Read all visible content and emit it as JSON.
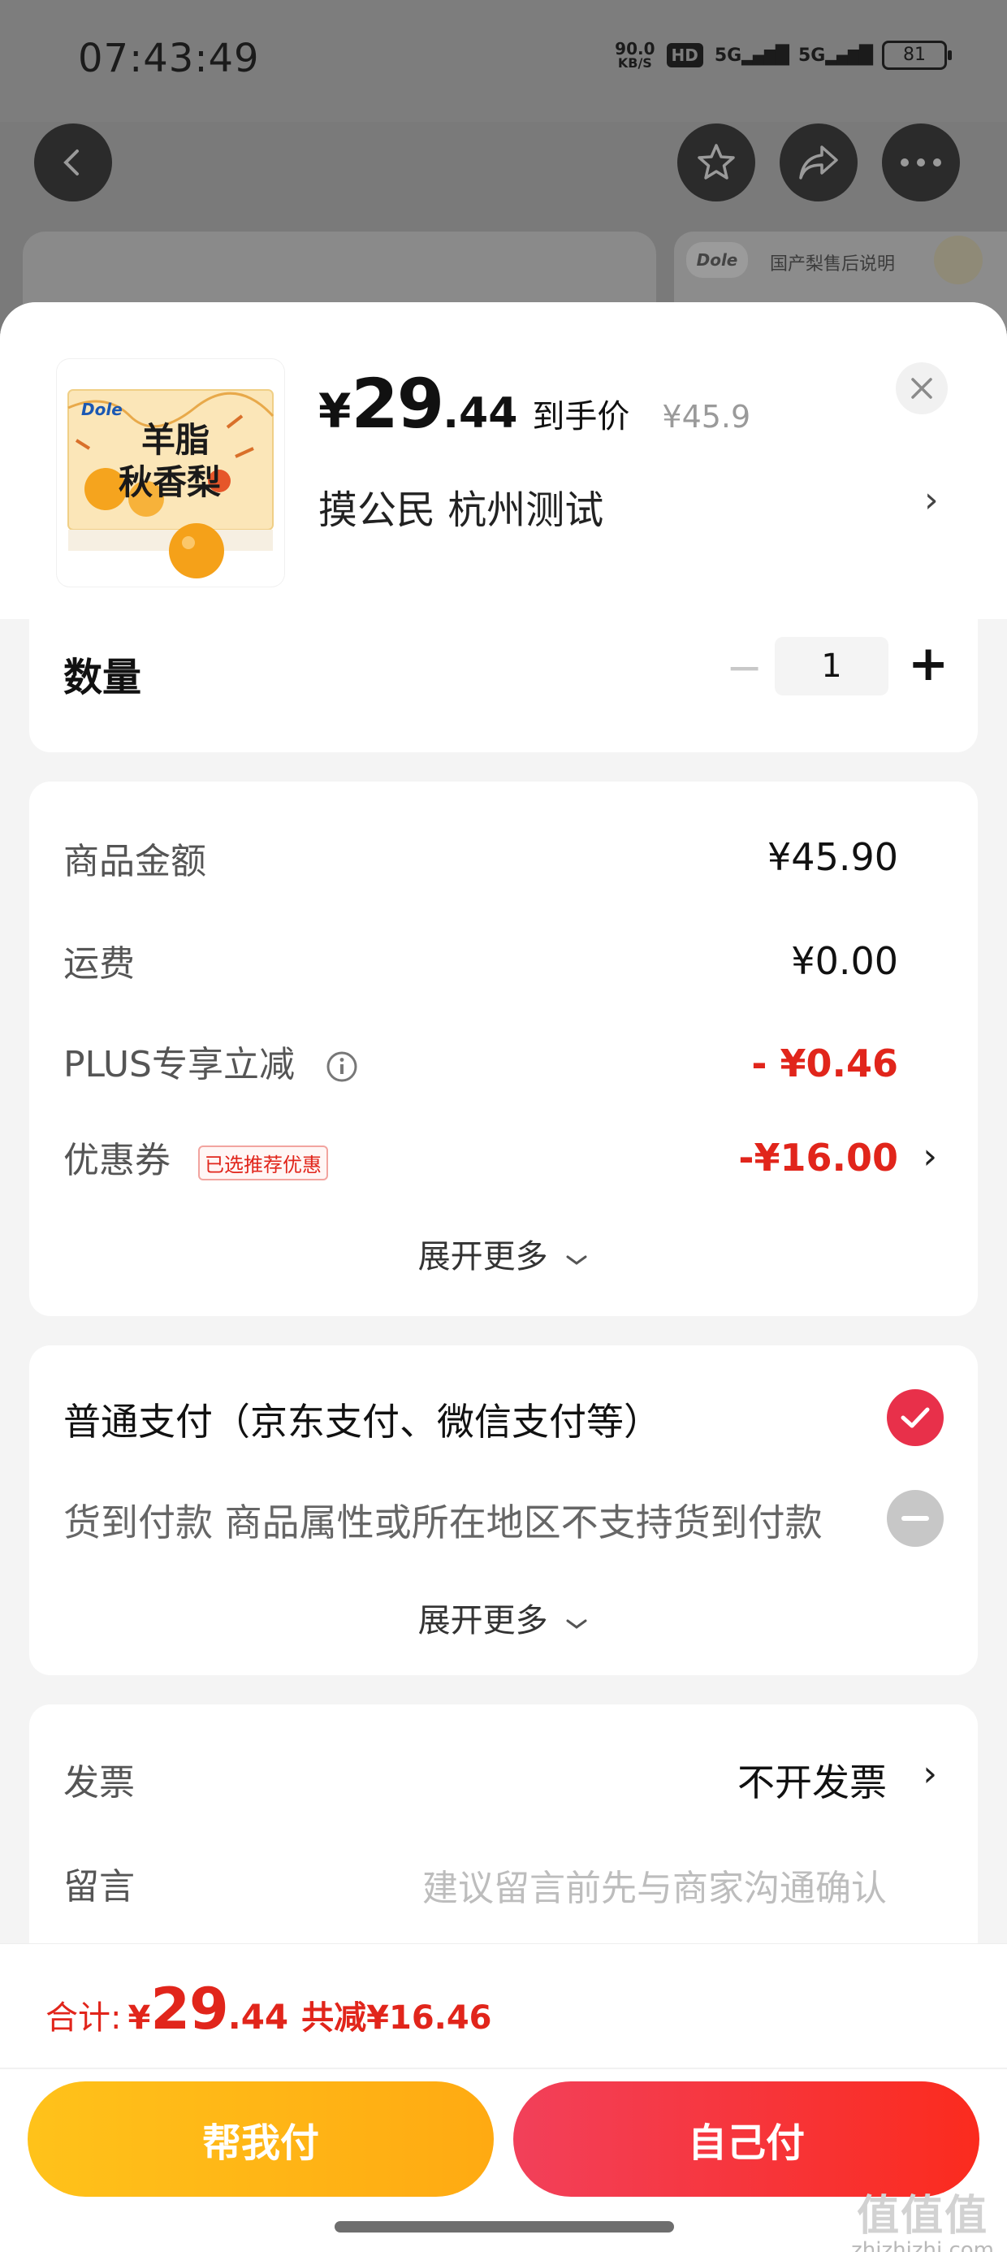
{
  "status_bar": {
    "time": "07:43:49",
    "net_speed_value": "90.0",
    "net_speed_unit": "KB/S",
    "hd_badge": "HD",
    "signal_1": "5G",
    "signal_2": "5G",
    "battery": "81"
  },
  "background_page": {
    "brand_badge": "Dole",
    "note": "国产梨售后说明"
  },
  "product": {
    "image_brand": "Dole",
    "image_title_line1": "羊脂",
    "image_title_line2": "秋香梨",
    "price_yen": "¥",
    "price_int": "29",
    "price_dec": ".44",
    "price_label": "到手价",
    "original_price": "¥45.9",
    "variant": "摸公民  杭州测试",
    "variant_arrow": "›"
  },
  "quantity": {
    "label": "数量",
    "minus": "−",
    "value": "1",
    "plus": "+"
  },
  "amounts": {
    "goods_label": "商品金额",
    "goods_value": "¥45.90",
    "shipping_label": "运费",
    "shipping_value": "¥0.00",
    "plus_label": "PLUS专享立减",
    "plus_value": "- ¥0.46",
    "coupon_label": "优惠券",
    "coupon_tag": "已选推荐优惠",
    "coupon_value": "-¥16.00",
    "coupon_arrow": "›",
    "expand": "展开更多"
  },
  "payment": {
    "normal_label": "普通支付（京东支付、微信支付等）",
    "cod_label": "货到付款 商品属性或所在地区不支持货到付款",
    "expand": "展开更多"
  },
  "extras": {
    "invoice_label": "发票",
    "invoice_value": "不开发票",
    "invoice_arrow": "›",
    "message_label": "留言",
    "message_placeholder": "建议留言前先与商家沟通确认"
  },
  "footer": {
    "total_label": "合计:",
    "total_yen": "¥",
    "total_int": "29",
    "total_dec": ".44",
    "total_saving": "共减¥16.46",
    "help_pay": "帮我付",
    "self_pay": "自己付"
  },
  "watermark": {
    "logo": "值值值",
    "site": "zhizhizhi.com"
  },
  "colors": {
    "price_red": "#e1251b",
    "help_button": "#ffb416",
    "self_button": "#f53a3a"
  }
}
